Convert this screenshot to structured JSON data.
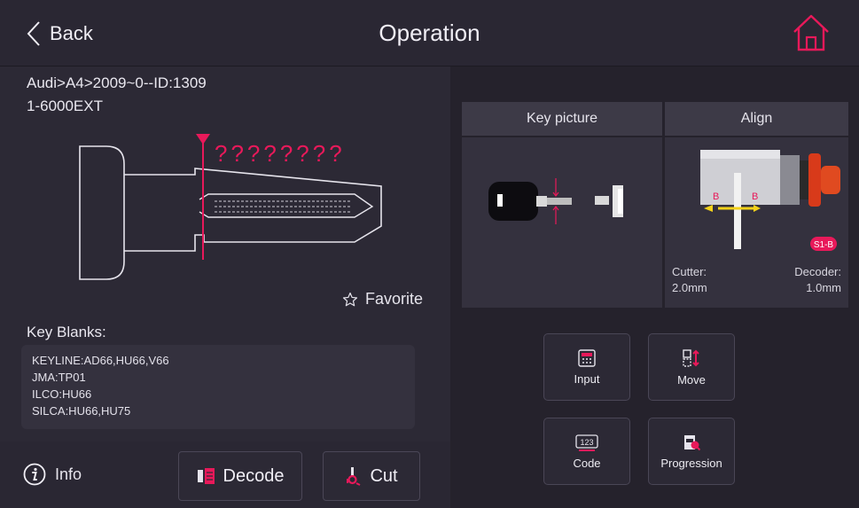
{
  "header": {
    "back_label": "Back",
    "title": "Operation"
  },
  "key_info": {
    "path": "Audi>A4>2009~0--ID:1309",
    "model": "1-6000EXT",
    "unknown_cuts": "????????",
    "favorite_label": "Favorite"
  },
  "key_blanks": {
    "title": "Key Blanks:",
    "lines": [
      "KEYLINE:AD66,HU66,V66",
      "JMA:TP01",
      "ILCO:HU66",
      "SILCA:HU66,HU75"
    ]
  },
  "bottom": {
    "info_label": "Info",
    "decode_label": "Decode",
    "cut_label": "Cut"
  },
  "table": {
    "key_picture_header": "Key picture",
    "align_header": "Align",
    "cutter_label": "Cutter:",
    "cutter_value": "2.0mm",
    "decoder_label": "Decoder:",
    "decoder_value": "1.0mm",
    "badge": "S1-B",
    "clamp_marks": [
      "B",
      "B"
    ]
  },
  "operations": {
    "input_label": "Input",
    "move_label": "Move",
    "code_label": "Code",
    "code_icon_text": "123",
    "progression_label": "Progression"
  },
  "colors": {
    "accent": "#e8195a",
    "background": "#26232f",
    "panel": "#2c2935",
    "yellow_mark": "#f5d21a"
  }
}
